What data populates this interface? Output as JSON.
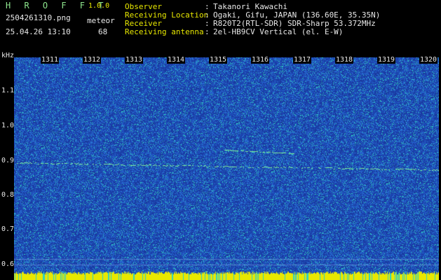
{
  "header": {
    "app_title": "H R O F F T",
    "app_version": "1.0.0",
    "file_name": "2504261310.png",
    "timestamp": "25.04.26 13:10",
    "event_type": "meteor",
    "event_count": "68"
  },
  "info": [
    {
      "label": "Observer",
      "sep": ":",
      "value": "Takanori Kawachi"
    },
    {
      "label": "Receiving Location",
      "sep": ":",
      "value": "Ogaki, Gifu, JAPAN (136.60E, 35.35N)"
    },
    {
      "label": "Receiver",
      "sep": ":",
      "value": "R820T2(RTL-SDR) SDR-Sharp 53.372MHz"
    },
    {
      "label": "Receiving antenna",
      "sep": ":",
      "value": "2el-HB9CV Vertical (el. E-W)"
    }
  ],
  "spectrogram": {
    "unit_label": "kHz",
    "y_ticks": [
      "1.1",
      "1.0",
      "0.9",
      "0.8",
      "0.7",
      "0.6"
    ],
    "x_ticks": [
      "1311",
      "1312",
      "1313",
      "1314",
      "1315",
      "1316",
      "1317",
      "1318",
      "1319",
      "1320"
    ],
    "y_range": [
      0.57,
      1.22
    ],
    "colors": {
      "background": "#1a3aa0",
      "noise_mid": "#2a78d8",
      "noise_hi": "#30d0c0",
      "signal": "#7ef09a",
      "baseline": "#e8e800"
    }
  }
}
